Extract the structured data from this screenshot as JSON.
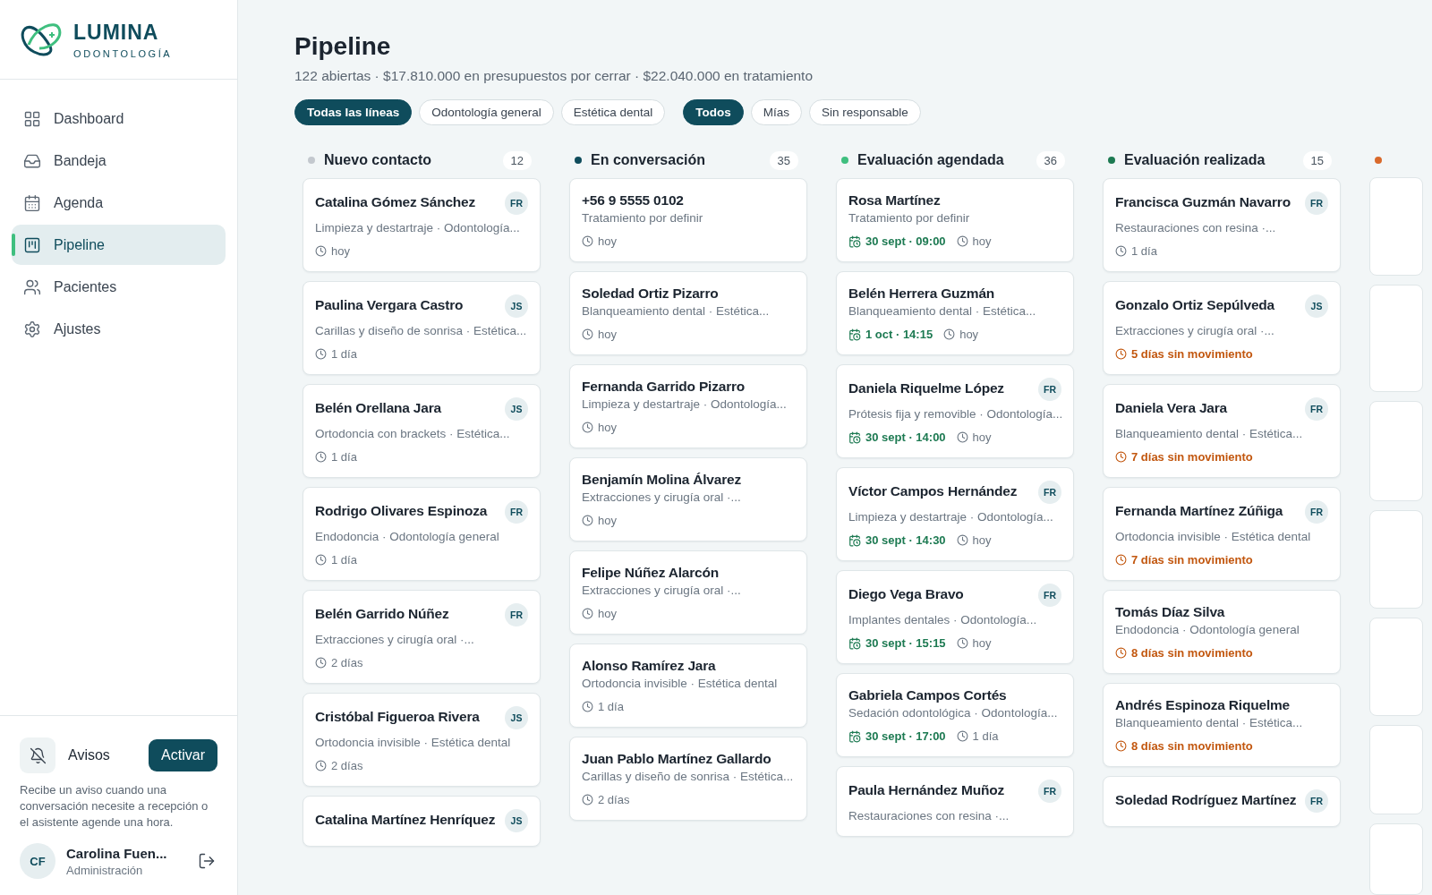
{
  "brand": {
    "name": "LUMINA",
    "tagline": "ODONTOLOGÍA"
  },
  "nav": [
    {
      "label": "Dashboard",
      "selected": false
    },
    {
      "label": "Bandeja",
      "selected": false
    },
    {
      "label": "Agenda",
      "selected": false
    },
    {
      "label": "Pipeline",
      "selected": true
    },
    {
      "label": "Pacientes",
      "selected": false
    },
    {
      "label": "Ajustes",
      "selected": false
    }
  ],
  "notices": {
    "label": "Avisos",
    "button": "Activar",
    "description": "Recibe un aviso cuando una conversación necesite a recepción o el asistente agende una hora."
  },
  "user": {
    "initials": "CF",
    "name": "Carolina Fuen...",
    "role": "Administración"
  },
  "page": {
    "title": "Pipeline",
    "summary": "122 abiertas · $17.810.000 en presupuestos por cerrar · $22.040.000 en tratamiento"
  },
  "filter_groups": [
    [
      {
        "label": "Todas las líneas",
        "selected": true
      },
      {
        "label": "Odontología general",
        "selected": false
      },
      {
        "label": "Estética dental",
        "selected": false
      }
    ],
    [
      {
        "label": "Todos",
        "selected": true
      },
      {
        "label": "Mías",
        "selected": false
      },
      {
        "label": "Sin responsable",
        "selected": false
      }
    ]
  ],
  "columns": [
    {
      "title": "Nuevo contacto",
      "count": "12",
      "color": "#c3c8ce",
      "cards": [
        {
          "name": "Catalina Gómez Sánchez",
          "owner": "FR",
          "detail": "Limpieza y destartraje · Odontología...",
          "age": "hoy",
          "stale": false
        },
        {
          "name": "Paulina Vergara Castro",
          "owner": "JS",
          "detail": "Carillas y diseño de sonrisa · Estética...",
          "age": "1 día",
          "stale": false
        },
        {
          "name": "Belén Orellana Jara",
          "owner": "JS",
          "detail": "Ortodoncia con brackets · Estética...",
          "age": "1 día",
          "stale": false
        },
        {
          "name": "Rodrigo Olivares Espinoza",
          "owner": "FR",
          "detail": "Endodoncia · Odontología general",
          "age": "1 día",
          "stale": false
        },
        {
          "name": "Belén Garrido Núñez",
          "owner": "FR",
          "detail": "Extracciones y cirugía oral ·...",
          "age": "2 días",
          "stale": false
        },
        {
          "name": "Cristóbal Figueroa Rivera",
          "owner": "JS",
          "detail": "Ortodoncia invisible · Estética dental",
          "age": "2 días",
          "stale": false
        },
        {
          "name": "Catalina Martínez Henríquez",
          "owner": "JS"
        }
      ]
    },
    {
      "title": "En conversación",
      "count": "35",
      "color": "#0f4c5c",
      "cards": [
        {
          "name": "+56 9 5555 0102",
          "detail": "Tratamiento por definir",
          "age": "hoy",
          "stale": false
        },
        {
          "name": "Soledad Ortiz Pizarro",
          "detail": "Blanqueamiento dental · Estética...",
          "age": "hoy",
          "stale": false
        },
        {
          "name": "Fernanda Garrido Pizarro",
          "detail": "Limpieza y destartraje · Odontología...",
          "age": "hoy",
          "stale": false
        },
        {
          "name": "Benjamín Molina Álvarez",
          "detail": "Extracciones y cirugía oral ·...",
          "age": "hoy",
          "stale": false
        },
        {
          "name": "Felipe Núñez Alarcón",
          "detail": "Extracciones y cirugía oral ·...",
          "age": "hoy",
          "stale": false
        },
        {
          "name": "Alonso Ramírez Jara",
          "detail": "Ortodoncia invisible · Estética dental",
          "age": "1 día",
          "stale": false
        },
        {
          "name": "Juan Pablo Martínez Gallardo",
          "detail": "Carillas y diseño de sonrisa · Estética...",
          "age": "2 días",
          "stale": false
        }
      ]
    },
    {
      "title": "Evaluación agendada",
      "count": "36",
      "color": "#3fbf7f",
      "cards": [
        {
          "name": "Rosa Martínez",
          "detail": "Tratamiento por definir",
          "appointment": "30 sept · 09:00",
          "age": "hoy",
          "stale": false
        },
        {
          "name": "Belén Herrera Guzmán",
          "detail": "Blanqueamiento dental · Estética...",
          "appointment": "1 oct · 14:15",
          "age": "hoy",
          "stale": false
        },
        {
          "name": "Daniela Riquelme López",
          "owner": "FR",
          "detail": "Prótesis fija y removible · Odontología...",
          "appointment": "30 sept · 14:00",
          "age": "hoy",
          "stale": false
        },
        {
          "name": "Víctor Campos Hernández",
          "owner": "FR",
          "detail": "Limpieza y destartraje · Odontología...",
          "appointment": "30 sept · 14:30",
          "age": "hoy",
          "stale": false
        },
        {
          "name": "Diego Vega Bravo",
          "owner": "FR",
          "detail": "Implantes dentales · Odontología...",
          "appointment": "30 sept · 15:15",
          "age": "hoy",
          "stale": false
        },
        {
          "name": "Gabriela Campos Cortés",
          "detail": "Sedación odontológica · Odontología...",
          "appointment": "30 sept · 17:00",
          "age": "1 día",
          "stale": false
        },
        {
          "name": "Paula Hernández Muñoz",
          "owner": "FR",
          "detail": "Restauraciones con resina ·..."
        }
      ]
    },
    {
      "title": "Evaluación realizada",
      "count": "15",
      "color": "#1d7a52",
      "cards": [
        {
          "name": "Francisca Guzmán Navarro",
          "owner": "FR",
          "detail": "Restauraciones con resina ·...",
          "age": "1 día",
          "stale": false
        },
        {
          "name": "Gonzalo Ortiz Sepúlveda",
          "owner": "JS",
          "detail": "Extracciones y cirugía oral ·...",
          "age": "5 días sin movimiento",
          "stale": true
        },
        {
          "name": "Daniela Vera Jara",
          "owner": "FR",
          "detail": "Blanqueamiento dental · Estética...",
          "age": "7 días sin movimiento",
          "stale": true
        },
        {
          "name": "Fernanda Martínez Zúñiga",
          "owner": "FR",
          "detail": "Ortodoncia invisible · Estética dental",
          "age": "7 días sin movimiento",
          "stale": true
        },
        {
          "name": "Tomás Díaz Silva",
          "detail": "Endodoncia · Odontología general",
          "age": "8 días sin movimiento",
          "stale": true
        },
        {
          "name": "Andrés Espinoza Riquelme",
          "detail": "Blanqueamiento dental · Estética...",
          "age": "8 días sin movimiento",
          "stale": true
        },
        {
          "name": "Soledad Rodríguez Martínez",
          "owner": "FR"
        }
      ]
    },
    {
      "color": "#d9692b",
      "cards": [
        {
          "kind": "cut"
        },
        {
          "kind": "cut"
        },
        {
          "kind": "cut"
        },
        {
          "kind": "cut"
        },
        {
          "kind": "cut"
        },
        {
          "kind": "cut"
        },
        {
          "kind": "cut"
        }
      ]
    }
  ]
}
